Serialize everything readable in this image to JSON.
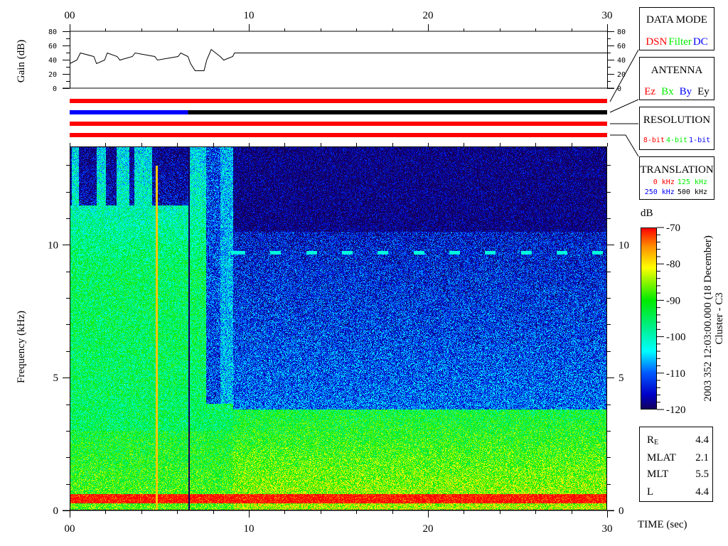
{
  "chart_data": {
    "type": "heatmap",
    "title": "Cluster - C3",
    "timestamp": "2003 352 12:03:00.000 (18 December)",
    "xlabel": "TIME (sec)",
    "ylabel": "Frequency (kHz)",
    "xlim": [
      0,
      30
    ],
    "ylim": [
      0,
      13.7
    ],
    "x_ticks": [
      "00",
      "10",
      "20",
      "30"
    ],
    "x_tick_values": [
      0,
      10,
      20,
      30
    ],
    "y_ticks": [
      "0",
      "5",
      "10"
    ],
    "y_tick_values": [
      0,
      5,
      10
    ],
    "colorbar": {
      "label": "dB",
      "range": [
        -120,
        -70
      ],
      "ticks": [
        "-70",
        "-80",
        "-90",
        "-100",
        "-110",
        "-120"
      ],
      "tick_values": [
        -70,
        -80,
        -90,
        -100,
        -110,
        -120
      ]
    },
    "gain_panel": {
      "ylabel": "Gain (dB)",
      "ylim": [
        0,
        80
      ],
      "y_ticks": [
        "80",
        "60",
        "40",
        "20",
        "0"
      ],
      "y_tick_values": [
        80,
        60,
        40,
        20,
        0
      ],
      "time": [
        0,
        0.4,
        0.6,
        1.35,
        1.5,
        1.95,
        2.1,
        2.65,
        2.8,
        3.5,
        3.65,
        4.75,
        4.9,
        6.05,
        6.2,
        6.6,
        6.75,
        7.0,
        7.5,
        7.65,
        7.9,
        8.4,
        8.6,
        9.1,
        9.2,
        30
      ],
      "gain": [
        35,
        40,
        50,
        45,
        35,
        40,
        50,
        45,
        40,
        45,
        50,
        45,
        40,
        45,
        50,
        45,
        35,
        25,
        25,
        40,
        55,
        45,
        40,
        45,
        50,
        50
      ]
    },
    "status_bars": [
      {
        "name": "data-mode",
        "segments": [
          {
            "from": 0,
            "to": 30,
            "color": "#ff0000"
          }
        ]
      },
      {
        "name": "antenna",
        "segments": [
          {
            "from": 0,
            "to": 6.6,
            "color": "#0000ff"
          },
          {
            "from": 6.6,
            "to": 30,
            "color": "#000000"
          }
        ]
      },
      {
        "name": "resolution",
        "segments": [
          {
            "from": 0,
            "to": 30,
            "color": "#ff0000"
          }
        ]
      },
      {
        "name": "translation",
        "segments": [
          {
            "from": 0,
            "to": 30,
            "color": "#ff0000"
          }
        ]
      }
    ]
  },
  "legends": {
    "data_mode": {
      "title": "DATA MODE",
      "items": [
        {
          "label": "DSN",
          "color": "#ff0000"
        },
        {
          "label": "Filter",
          "color": "#00ee00"
        },
        {
          "label": "DC",
          "color": "#0000ff"
        }
      ]
    },
    "antenna": {
      "title": "ANTENNA",
      "items": [
        {
          "label": "Ez",
          "color": "#ff0000"
        },
        {
          "label": "Bx",
          "color": "#00ee00"
        },
        {
          "label": "By",
          "color": "#0000ff"
        },
        {
          "label": "Ey",
          "color": "#000000"
        }
      ]
    },
    "resolution": {
      "title": "RESOLUTION",
      "items": [
        {
          "label": "8-bit",
          "color": "#ff0000"
        },
        {
          "label": "4-bit",
          "color": "#00ee00"
        },
        {
          "label": "1-bit",
          "color": "#0000ff"
        }
      ]
    },
    "translation": {
      "title": "TRANSLATION",
      "items": [
        {
          "label": "0 kHz",
          "color": "#ff0000"
        },
        {
          "label": "125 kHz",
          "color": "#00ee00"
        },
        {
          "label": "250 kHz",
          "color": "#0000ff"
        },
        {
          "label": "500 kHz",
          "color": "#000000"
        }
      ]
    }
  },
  "orbit": [
    {
      "label": "R",
      "sub": "E",
      "value": "4.4"
    },
    {
      "label": "MLAT",
      "value": "2.1"
    },
    {
      "label": "MLT",
      "value": "5.5"
    },
    {
      "label": "L",
      "value": "4.4"
    }
  ]
}
